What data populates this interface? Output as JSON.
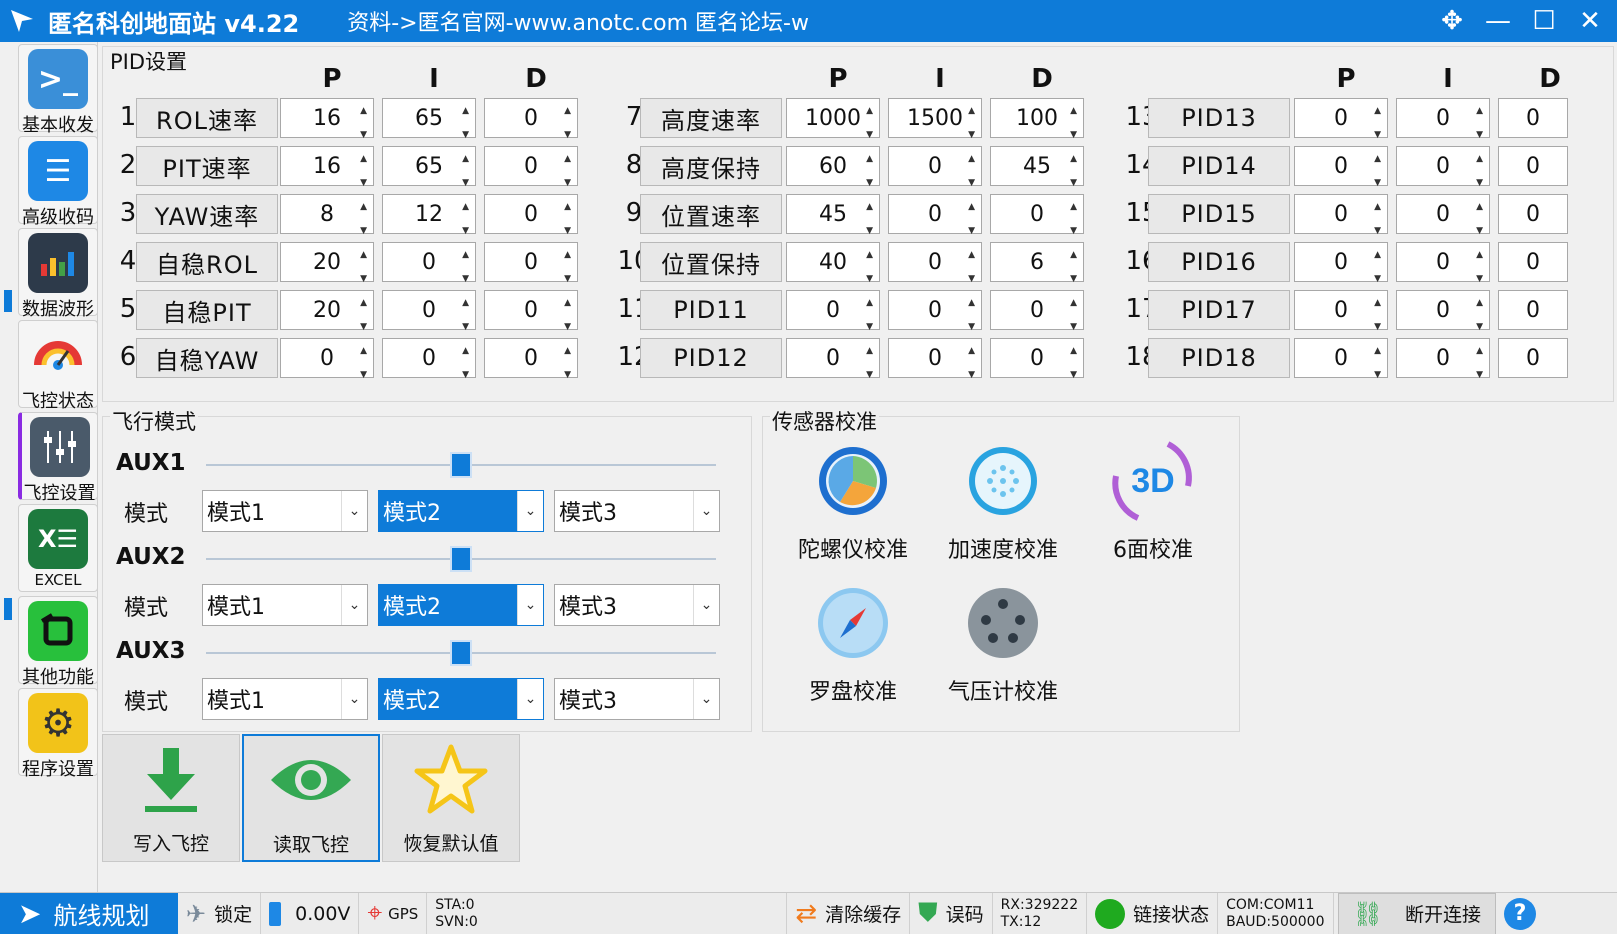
{
  "window": {
    "title": "匿名科创地面站 v4.22",
    "subtitle": "资料->匿名官网-www.anotc.com  匿名论坛-w",
    "buttons": [
      "✥",
      "—",
      "☐",
      "✕"
    ]
  },
  "sidebar": {
    "items": [
      {
        "label": "基本收发",
        "icon": "terminal-icon",
        "color": "#3a8fd8"
      },
      {
        "label": "高级收码",
        "icon": "document-icon",
        "color": "#1e88e5"
      },
      {
        "label": "数据波形",
        "icon": "bar-chart-icon",
        "color": "#2d3a4a"
      },
      {
        "label": "飞控状态",
        "icon": "gauge-icon",
        "color": "#f0f0f0"
      },
      {
        "label": "飞控设置",
        "icon": "sliders-icon",
        "color": "#4a5a6a"
      },
      {
        "label": "EXCEL",
        "icon": "excel-icon",
        "color": "#1d7a3e"
      },
      {
        "label": "其他功能",
        "icon": "other-icon",
        "color": "#28c03c"
      },
      {
        "label": "程序设置",
        "icon": "gear-icon",
        "color": "#f2c319"
      }
    ]
  },
  "pid": {
    "title": "PID设置",
    "headers": [
      "P",
      "I",
      "D"
    ],
    "rows": [
      {
        "num": "1",
        "name": "ROL速率",
        "p": "16",
        "i": "65",
        "d": "0"
      },
      {
        "num": "2",
        "name": "PIT速率",
        "p": "16",
        "i": "65",
        "d": "0"
      },
      {
        "num": "3",
        "name": "YAW速率",
        "p": "8",
        "i": "12",
        "d": "0"
      },
      {
        "num": "4",
        "name": "自稳ROL",
        "p": "20",
        "i": "0",
        "d": "0"
      },
      {
        "num": "5",
        "name": "自稳PIT",
        "p": "20",
        "i": "0",
        "d": "0"
      },
      {
        "num": "6",
        "name": "自稳YAW",
        "p": "0",
        "i": "0",
        "d": "0"
      },
      {
        "num": "7",
        "name": "高度速率",
        "p": "1000",
        "i": "1500",
        "d": "100"
      },
      {
        "num": "8",
        "name": "高度保持",
        "p": "60",
        "i": "0",
        "d": "45"
      },
      {
        "num": "9",
        "name": "位置速率",
        "p": "45",
        "i": "0",
        "d": "0"
      },
      {
        "num": "10",
        "name": "位置保持",
        "p": "40",
        "i": "0",
        "d": "6"
      },
      {
        "num": "11",
        "name": "PID11",
        "p": "0",
        "i": "0",
        "d": "0"
      },
      {
        "num": "12",
        "name": "PID12",
        "p": "0",
        "i": "0",
        "d": "0"
      },
      {
        "num": "13",
        "name": "PID13",
        "p": "0",
        "i": "0",
        "d": "0"
      },
      {
        "num": "14",
        "name": "PID14",
        "p": "0",
        "i": "0",
        "d": "0"
      },
      {
        "num": "15",
        "name": "PID15",
        "p": "0",
        "i": "0",
        "d": "0"
      },
      {
        "num": "16",
        "name": "PID16",
        "p": "0",
        "i": "0",
        "d": "0"
      },
      {
        "num": "17",
        "name": "PID17",
        "p": "0",
        "i": "0",
        "d": "0"
      },
      {
        "num": "18",
        "name": "PID18",
        "p": "0",
        "i": "0",
        "d": "0"
      }
    ]
  },
  "flight_mode": {
    "title": "飞行模式",
    "mode_label": "模式",
    "aux": [
      {
        "name": "AUX1",
        "slider_fraction": 0.5,
        "modes": [
          "模式1",
          "模式2",
          "模式3"
        ],
        "selected": 1
      },
      {
        "name": "AUX2",
        "slider_fraction": 0.5,
        "modes": [
          "模式1",
          "模式2",
          "模式3"
        ],
        "selected": 1
      },
      {
        "name": "AUX3",
        "slider_fraction": 0.5,
        "modes": [
          "模式1",
          "模式2",
          "模式3"
        ],
        "selected": 1
      }
    ]
  },
  "sensor_calib": {
    "title": "传感器校准",
    "items": [
      {
        "label": "陀螺仪校准",
        "icon": "gyro-icon"
      },
      {
        "label": "加速度校准",
        "icon": "accelerometer-icon"
      },
      {
        "label": "6面校准",
        "icon": "3d-rotate-icon",
        "icon_text": "3D"
      },
      {
        "label": "罗盘校准",
        "icon": "compass-icon"
      },
      {
        "label": "气压计校准",
        "icon": "barometer-icon"
      }
    ]
  },
  "actions": [
    {
      "label": "写入飞控",
      "icon": "download-icon"
    },
    {
      "label": "读取飞控",
      "icon": "eye-icon"
    },
    {
      "label": "恢复默认值",
      "icon": "star-icon"
    }
  ],
  "status": {
    "route": "航线规划",
    "lock": "锁定",
    "voltage": "0.00V",
    "gps": "GPS",
    "sta": "STA:0",
    "svn": "SVN:0",
    "clear_cache": "清除缓存",
    "error_code": "误码",
    "rx": "RX:329222",
    "tx": "TX:12",
    "link_status": "链接状态",
    "com": "COM:COM11",
    "baud": "BAUD:500000",
    "disconnect": "断开连接",
    "help": "?"
  }
}
